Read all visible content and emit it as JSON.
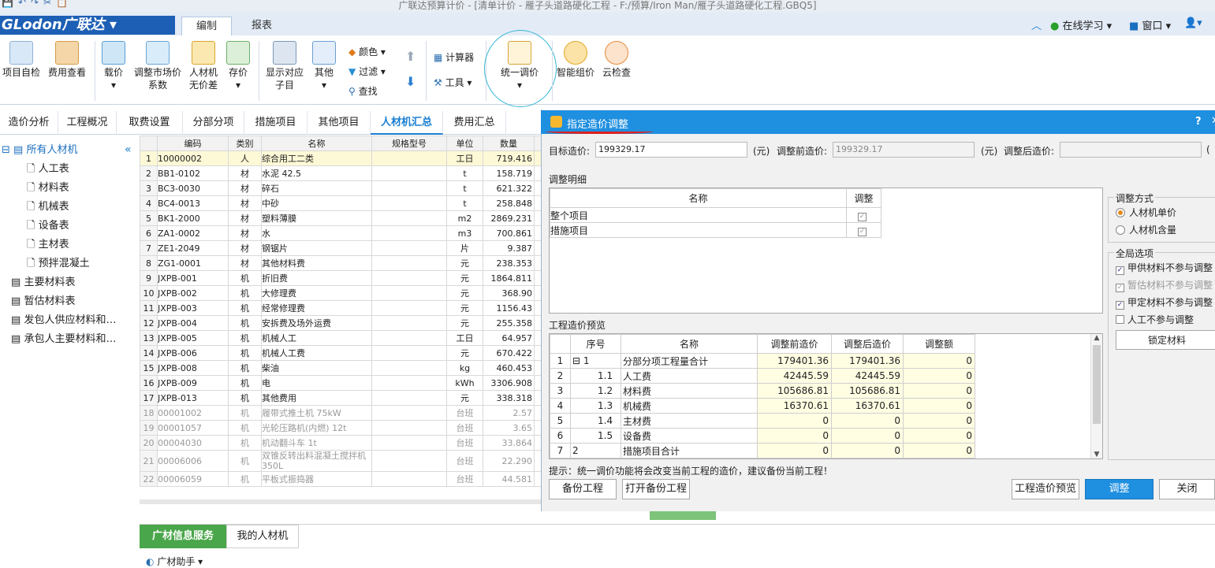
{
  "titlebar": {
    "title": "广联达预算计价 - [清单计价 - 雁子头道路硬化工程 - F:/预算/Iron Man/雁子头道路硬化工程.GBQ5]"
  },
  "brand": {
    "logo_text": "GLodon广联达 ▾"
  },
  "main_tabs": [
    "编制",
    "报表"
  ],
  "top_right": {
    "learn": "在线学习",
    "window": "窗口"
  },
  "ribbon": {
    "project_check": "项目自检",
    "fee_view": "费用查看",
    "price_tool": "载价",
    "market_price": "调整市场价",
    "market_price2": "系数",
    "labor": "人材机",
    "labor2": "无价差",
    "stock_price": "存价",
    "show_sub": "显示对应",
    "show_sub2": "子目",
    "other": "其他",
    "color": "颜色",
    "filter": "过滤",
    "find": "查找",
    "calculator": "计算器",
    "tools": "工具",
    "unified_adjust": "统一调价",
    "smart_price": "智能组价",
    "cloud_check": "云检查"
  },
  "sub_tabs": [
    "造价分析",
    "工程概况",
    "取费设置",
    "分部分项",
    "措施项目",
    "其他项目",
    "人材机汇总",
    "费用汇总"
  ],
  "tree": {
    "root": "所有人材机",
    "children": [
      "人工表",
      "材料表",
      "机械表",
      "设备表",
      "主材表",
      "预拌混凝土"
    ],
    "groups": [
      "主要材料表",
      "暂估材料表",
      "发包人供应材料和…",
      "承包人主要材料和…"
    ]
  },
  "grid": {
    "headers": [
      "编码",
      "类别",
      "名称",
      "规格型号",
      "单位",
      "数量"
    ],
    "rows": [
      {
        "n": "1",
        "code": "10000002",
        "cat": "人",
        "name": "综合用工二类",
        "spec": "",
        "unit": "工日",
        "qty": "719.416"
      },
      {
        "n": "2",
        "code": "BB1-0102",
        "cat": "材",
        "name": "水泥 42.5",
        "spec": "",
        "unit": "t",
        "qty": "158.719"
      },
      {
        "n": "3",
        "code": "BC3-0030",
        "cat": "材",
        "name": "碎石",
        "spec": "",
        "unit": "t",
        "qty": "621.322"
      },
      {
        "n": "4",
        "code": "BC4-0013",
        "cat": "材",
        "name": "中砂",
        "spec": "",
        "unit": "t",
        "qty": "258.848"
      },
      {
        "n": "5",
        "code": "BK1-2000",
        "cat": "材",
        "name": "塑料薄膜",
        "spec": "",
        "unit": "m2",
        "qty": "2869.231"
      },
      {
        "n": "6",
        "code": "ZA1-0002",
        "cat": "材",
        "name": "水",
        "spec": "",
        "unit": "m3",
        "qty": "700.861"
      },
      {
        "n": "7",
        "code": "ZE1-2049",
        "cat": "材",
        "name": "钢锯片",
        "spec": "",
        "unit": "片",
        "qty": "9.387"
      },
      {
        "n": "8",
        "code": "ZG1-0001",
        "cat": "材",
        "name": "其他材料费",
        "spec": "",
        "unit": "元",
        "qty": "238.353"
      },
      {
        "n": "9",
        "code": "JXPB-001",
        "cat": "机",
        "name": "折旧费",
        "spec": "",
        "unit": "元",
        "qty": "1864.811"
      },
      {
        "n": "10",
        "code": "JXPB-002",
        "cat": "机",
        "name": "大修理费",
        "spec": "",
        "unit": "元",
        "qty": "368.90"
      },
      {
        "n": "11",
        "code": "JXPB-003",
        "cat": "机",
        "name": "经常修理费",
        "spec": "",
        "unit": "元",
        "qty": "1156.43"
      },
      {
        "n": "12",
        "code": "JXPB-004",
        "cat": "机",
        "name": "安拆费及场外运费",
        "spec": "",
        "unit": "元",
        "qty": "255.358"
      },
      {
        "n": "13",
        "code": "JXPB-005",
        "cat": "机",
        "name": "机械人工",
        "spec": "",
        "unit": "工日",
        "qty": "64.957"
      },
      {
        "n": "14",
        "code": "JXPB-006",
        "cat": "机",
        "name": "机械人工费",
        "spec": "",
        "unit": "元",
        "qty": "670.422"
      },
      {
        "n": "15",
        "code": "JXPB-008",
        "cat": "机",
        "name": "柴油",
        "spec": "",
        "unit": "kg",
        "qty": "460.453"
      },
      {
        "n": "16",
        "code": "JXPB-009",
        "cat": "机",
        "name": "电",
        "spec": "",
        "unit": "kWh",
        "qty": "3306.908"
      },
      {
        "n": "17",
        "code": "JXPB-013",
        "cat": "机",
        "name": "其他费用",
        "spec": "",
        "unit": "元",
        "qty": "338.318"
      },
      {
        "n": "18",
        "code": "00001002",
        "cat": "机",
        "name": "履带式推土机 75kW",
        "spec": "",
        "unit": "台班",
        "qty": "2.57"
      },
      {
        "n": "19",
        "code": "00001057",
        "cat": "机",
        "name": "光轮压路机(内燃) 12t",
        "spec": "",
        "unit": "台班",
        "qty": "3.65"
      },
      {
        "n": "20",
        "code": "00004030",
        "cat": "机",
        "name": "机动翻斗车 1t",
        "spec": "",
        "unit": "台班",
        "qty": "33.864"
      },
      {
        "n": "21",
        "code": "00006006",
        "cat": "机",
        "name": "双锥反转出料混凝土搅拌机 350L",
        "spec": "",
        "unit": "台班",
        "qty": "22.290"
      },
      {
        "n": "22",
        "code": "00006059",
        "cat": "机",
        "name": "平板式振捣器",
        "spec": "",
        "unit": "台班",
        "qty": "44.581"
      }
    ]
  },
  "bottom": {
    "tab1": "广材信息服务",
    "tab2": "我的人材机",
    "row": "广材助手"
  },
  "dialog": {
    "title": "指定造价调整",
    "help": "?",
    "target_label": "目标造价:",
    "target_value": "199329.17",
    "unit": "(元)",
    "before_label": "调整前造价:",
    "before_value": "199329.17",
    "after_label": "调整后造价:",
    "after_value": "",
    "detail_title": "调整明细",
    "detail_headers": [
      "名称",
      "调整"
    ],
    "detail_rows": [
      {
        "name": "整个项目",
        "checked": "✓"
      },
      {
        "name": "措施项目",
        "checked": "✓"
      }
    ],
    "mode_title": "调整方式",
    "mode_options": [
      "人材机单价",
      "人材机含量"
    ],
    "global_title": "全局选项",
    "global_options": [
      {
        "label": "甲供材料不参与调整",
        "checked": "✓"
      },
      {
        "label": "暂估材料不参与调整",
        "checked": "✓"
      },
      {
        "label": "甲定材料不参与调整",
        "checked": "✓"
      },
      {
        "label": "人工不参与调整",
        "checked": ""
      }
    ],
    "lock_button": "锁定材料",
    "preview_title": "工程造价预览",
    "preview_headers": [
      "序号",
      "名称",
      "调整前造价",
      "调整后造价",
      "调整额"
    ],
    "preview_rows": [
      {
        "n": "1",
        "seq": "1",
        "name": "分部分项工程量合计",
        "before": "179401.36",
        "after": "179401.36",
        "diff": "0"
      },
      {
        "n": "2",
        "seq": "1.1",
        "name": "人工费",
        "before": "42445.59",
        "after": "42445.59",
        "diff": "0"
      },
      {
        "n": "3",
        "seq": "1.2",
        "name": "材料费",
        "before": "105686.81",
        "after": "105686.81",
        "diff": "0"
      },
      {
        "n": "4",
        "seq": "1.3",
        "name": "机械费",
        "before": "16370.61",
        "after": "16370.61",
        "diff": "0"
      },
      {
        "n": "5",
        "seq": "1.4",
        "name": "主材费",
        "before": "0",
        "after": "0",
        "diff": "0"
      },
      {
        "n": "6",
        "seq": "1.5",
        "name": "设备费",
        "before": "0",
        "after": "0",
        "diff": "0"
      },
      {
        "n": "7",
        "seq": "2",
        "name": "措施项目合计",
        "before": "0",
        "after": "0",
        "diff": "0"
      }
    ],
    "tip": "提示：统一调价功能将会改变当前工程的造价，建议备份当前工程！",
    "buttons": {
      "backup": "备份工程",
      "open_backup": "打开备份工程",
      "preview": "工程造价预览",
      "adjust": "调整",
      "close": "关闭"
    }
  },
  "colors": {
    "accent": "#1f8fe0",
    "brand": "#1d5fb5",
    "highlight": "#fffde2",
    "annotation": "#e0201e"
  }
}
